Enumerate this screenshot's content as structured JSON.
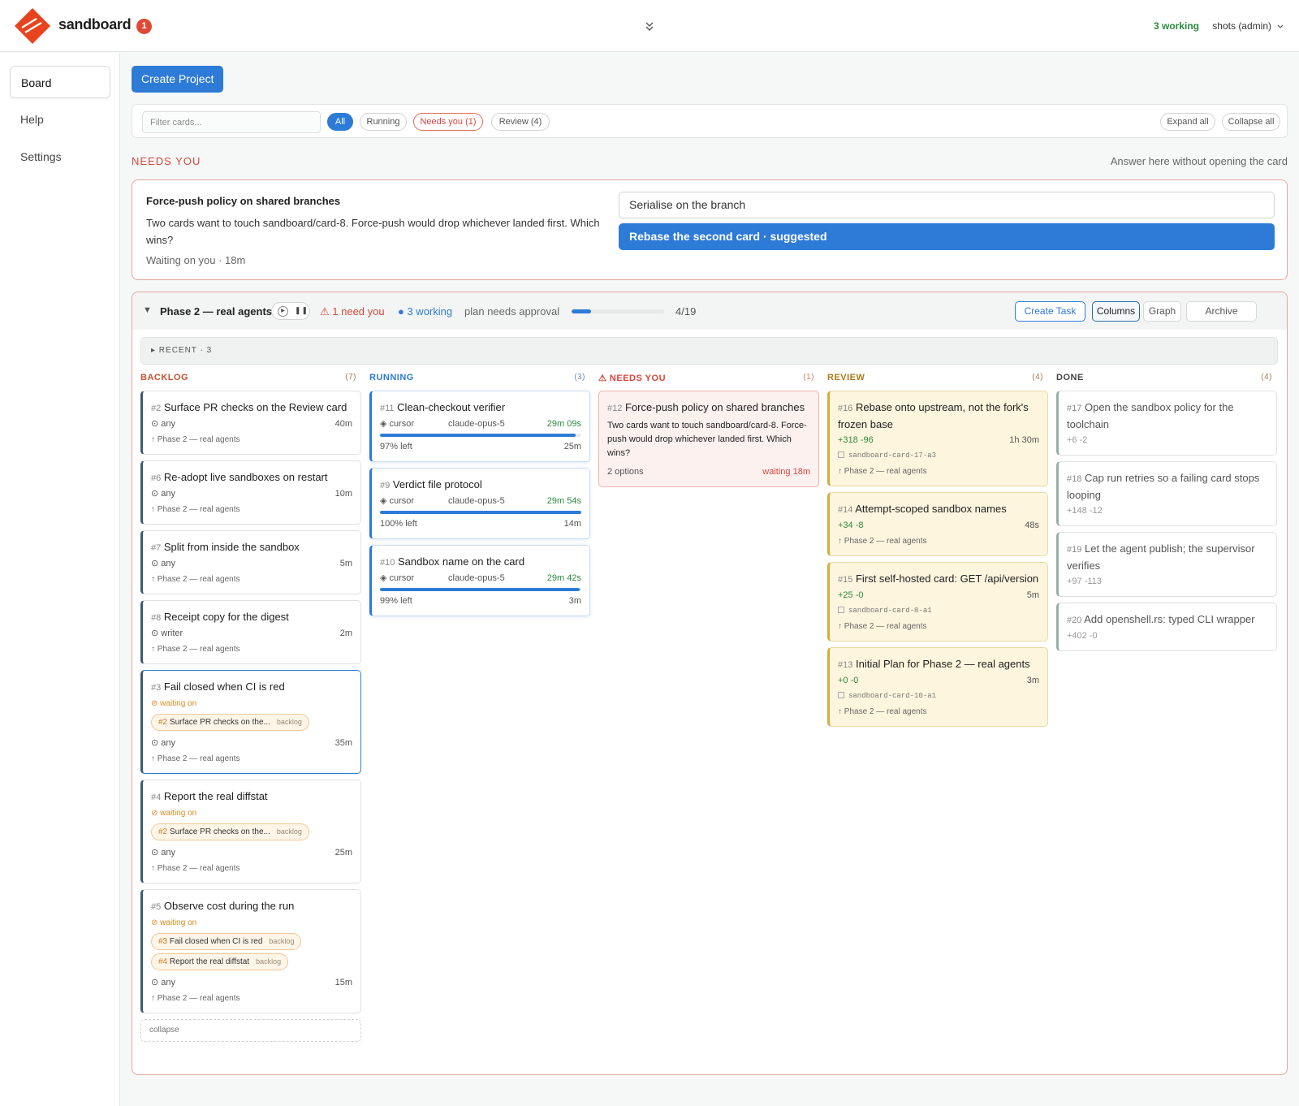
{
  "app": {
    "name": "sandboard",
    "notifications": "1"
  },
  "topbar": {
    "working": "3 working",
    "user": "shots (admin)"
  },
  "sidebar": {
    "items": [
      {
        "label": "Board"
      },
      {
        "label": "Help"
      },
      {
        "label": "Settings"
      }
    ]
  },
  "toolbar": {
    "create_project": "Create Project"
  },
  "filters": {
    "placeholder": "Filter cards...",
    "pills": [
      {
        "label": "All"
      },
      {
        "label": "Running"
      },
      {
        "label": "Needs you (1)"
      },
      {
        "label": "Review (4)"
      }
    ],
    "expand_all": "Expand all",
    "collapse_all": "Collapse all"
  },
  "needs_you": {
    "title": "NEEDS YOU",
    "hint": "Answer here without opening the card",
    "question": {
      "title": "Force-push policy on shared branches",
      "text": "Two cards want to touch sandboard/card-8. Force-push would drop whichever landed first. Which wins?",
      "meta": "Waiting on you · 18m",
      "options": [
        "Serialise on the branch",
        "Rebase the second card · suggested"
      ]
    }
  },
  "phase": {
    "title": "Phase 2 — real agents",
    "need": "⚠ 1 need you",
    "working": "● 3 working",
    "plan": "plan needs approval",
    "count": "4/19",
    "progress_fraction": 0.21,
    "buttons": {
      "create_task": "Create Task",
      "columns": "Columns",
      "graph": "Graph",
      "archive": "Archive"
    },
    "recent": "▸ RECENT · 3",
    "collapse": "collapse"
  },
  "columns": {
    "backlog": {
      "title": "BACKLOG",
      "count": "(7)",
      "cards": [
        {
          "num": "#2",
          "title": "Surface PR checks on the Review card",
          "agent": "⊙ any",
          "time": "40m",
          "phase": "↑ Phase 2 — real agents"
        },
        {
          "num": "#6",
          "title": "Re-adopt live sandboxes on restart",
          "agent": "⊙ any",
          "time": "10m",
          "phase": "↑ Phase 2 — real agents"
        },
        {
          "num": "#7",
          "title": "Split from inside the sandbox",
          "agent": "⊙ any",
          "time": "5m",
          "phase": "↑ Phase 2 — real agents"
        },
        {
          "num": "#8",
          "title": "Receipt copy for the digest",
          "agent": "⊙ writer",
          "time": "2m",
          "phase": "↑ Phase 2 — real agents"
        },
        {
          "num": "#3",
          "title": "Fail closed when CI is red",
          "waiting": "⊘ waiting on",
          "deps": [
            {
              "num": "#2",
              "label": "Surface PR checks on the...",
              "tag": "backlog"
            }
          ],
          "agent": "⊙ any",
          "time": "35m",
          "phase": "↑ Phase 2 — real agents"
        },
        {
          "num": "#4",
          "title": "Report the real diffstat",
          "waiting": "⊘ waiting on",
          "deps": [
            {
              "num": "#2",
              "label": "Surface PR checks on the...",
              "tag": "backlog"
            }
          ],
          "agent": "⊙ any",
          "time": "25m",
          "phase": "↑ Phase 2 — real agents"
        },
        {
          "num": "#5",
          "title": "Observe cost during the run",
          "waiting": "⊘ waiting on",
          "deps": [
            {
              "num": "#3",
              "label": "Fail closed when CI is red",
              "tag": "backlog"
            },
            {
              "num": "#4",
              "label": "Report the real diffstat",
              "tag": "backlog"
            }
          ],
          "agent": "⊙ any",
          "time": "15m",
          "phase": "↑ Phase 2 — real agents"
        }
      ]
    },
    "running": {
      "title": "RUNNING",
      "count": "(3)",
      "cards": [
        {
          "num": "#11",
          "title": "Clean-checkout verifier",
          "agent": "◈ cursor",
          "model": "claude-opus-5",
          "elapsed": "29m 09s",
          "left": "97% left",
          "progress": 0.97,
          "time": "25m"
        },
        {
          "num": "#9",
          "title": "Verdict file protocol",
          "agent": "◈ cursor",
          "model": "claude-opus-5",
          "elapsed": "29m 54s",
          "left": "100% left",
          "progress": 1.0,
          "time": "14m"
        },
        {
          "num": "#10",
          "title": "Sandbox name on the card",
          "agent": "◈ cursor",
          "model": "claude-opus-5",
          "elapsed": "29m 42s",
          "left": "99% left",
          "progress": 0.99,
          "time": "3m"
        }
      ]
    },
    "needs": {
      "title": "⚠ NEEDS YOU",
      "count": "(1)",
      "cards": [
        {
          "num": "#12",
          "title": "Force-push policy on shared branches",
          "text": "Two cards want to touch sandboard/card-8. Force-push would drop whichever landed first. Which wins?",
          "options": "2 options",
          "waiting": "waiting 18m"
        }
      ]
    },
    "review": {
      "title": "REVIEW",
      "count": "(4)",
      "cards": [
        {
          "num": "#16",
          "title": "Rebase onto upstream, not the fork's frozen base",
          "diff": "+318 -96",
          "time": "1h 30m",
          "branch": "sandboard-card-17-a3",
          "phase": "↑ Phase 2 — real agents"
        },
        {
          "num": "#14",
          "title": "Attempt-scoped sandbox names",
          "diff": "+34 -8",
          "time": "48s",
          "phase": "↑ Phase 2 — real agents"
        },
        {
          "num": "#15",
          "title": "First self-hosted card: GET /api/version",
          "diff": "+25 -0",
          "time": "5m",
          "branch": "sandboard-card-8-a1",
          "phase": "↑ Phase 2 — real agents"
        },
        {
          "num": "#13",
          "title": "Initial Plan for Phase 2 — real agents",
          "diff": "+0 -0",
          "time": "3m",
          "branch": "sandboard-card-10-a1",
          "phase": "↑ Phase 2 — real agents"
        }
      ]
    },
    "done": {
      "title": "DONE",
      "count": "(4)",
      "cards": [
        {
          "num": "#17",
          "title": "Open the sandbox policy for the toolchain",
          "diff": "+6 -2"
        },
        {
          "num": "#18",
          "title": "Cap run retries so a failing card stops looping",
          "diff": "+148 -12"
        },
        {
          "num": "#19",
          "title": "Let the agent publish; the supervisor verifies",
          "diff": "+97 -113"
        },
        {
          "num": "#20",
          "title": "Add openshell.rs: typed CLI wrapper",
          "diff": "+402 -0"
        }
      ]
    }
  },
  "colors": {
    "accent": "#2d7bd6",
    "brand": "#e8431f",
    "danger": "#d6473b",
    "success": "#2b8a3e",
    "review": "#d9a93a"
  }
}
